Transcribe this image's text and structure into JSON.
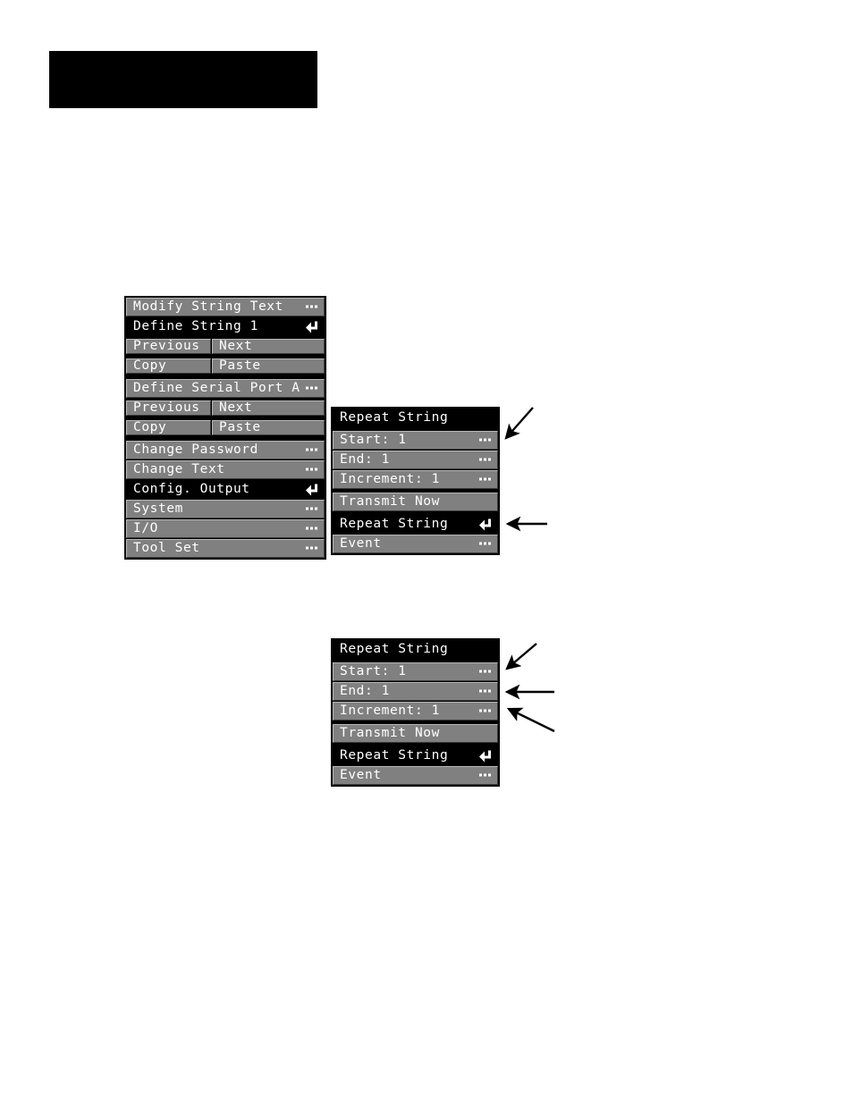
{
  "page": {
    "background": "#ffffff",
    "redaction_bar_color": "#000000"
  },
  "colors": {
    "lcd_background": "#000000",
    "row_unselected": "#808080",
    "row_selected": "#000000",
    "text": "#ffffff"
  },
  "left_panel": {
    "name": "configuration-menu",
    "groups": [
      {
        "name": "string-group",
        "rows": [
          {
            "type": "single",
            "label": "Modify String Text",
            "marker": "ellipsis-icon",
            "selected": false
          },
          {
            "type": "single",
            "label": "Define String 1",
            "marker": "return-icon",
            "selected": true
          },
          {
            "type": "split",
            "left": "Previous",
            "right": "Next",
            "selected": false
          },
          {
            "type": "split",
            "left": "Copy",
            "right": "Paste",
            "selected": false
          }
        ]
      },
      {
        "name": "serial-port-group",
        "rows": [
          {
            "type": "single",
            "label": "Define Serial Port A",
            "marker": "ellipsis-icon",
            "selected": false
          },
          {
            "type": "split",
            "left": "Previous",
            "right": "Next",
            "selected": false
          },
          {
            "type": "split",
            "left": "Copy",
            "right": "Paste",
            "selected": false
          }
        ]
      },
      {
        "name": "main-menu-group",
        "rows": [
          {
            "type": "single",
            "label": "Change Password",
            "marker": "ellipsis-icon",
            "selected": false
          },
          {
            "type": "single",
            "label": "Change Text",
            "marker": "ellipsis-icon",
            "selected": false
          },
          {
            "type": "single",
            "label": "Config. Output",
            "marker": "return-icon",
            "selected": true
          },
          {
            "type": "single",
            "label": "System",
            "marker": "ellipsis-icon",
            "selected": false
          },
          {
            "type": "single",
            "label": "I/O",
            "marker": "ellipsis-icon",
            "selected": false
          },
          {
            "type": "single",
            "label": "Tool Set",
            "marker": "ellipsis-icon",
            "selected": false
          }
        ]
      }
    ]
  },
  "repeat_panel_top": {
    "name": "repeat-string-menu-top",
    "groups": [
      {
        "name": "title-group",
        "rows": [
          {
            "type": "single",
            "label": "Repeat String",
            "marker": "none",
            "selected": true
          }
        ]
      },
      {
        "name": "parameters-group",
        "rows": [
          {
            "type": "single",
            "label": "Start: 1",
            "marker": "ellipsis-icon",
            "selected": false
          },
          {
            "type": "single",
            "label": "End: 1",
            "marker": "ellipsis-icon",
            "selected": false
          },
          {
            "type": "single",
            "label": "Increment: 1",
            "marker": "ellipsis-icon",
            "selected": false
          }
        ]
      },
      {
        "name": "transmit-group",
        "rows": [
          {
            "type": "single",
            "label": "Transmit Now",
            "marker": "none",
            "selected": false
          }
        ]
      },
      {
        "name": "mode-group",
        "rows": [
          {
            "type": "single",
            "label": "Repeat String",
            "marker": "return-icon",
            "selected": true
          },
          {
            "type": "single",
            "label": "Event",
            "marker": "ellipsis-icon",
            "selected": false
          }
        ]
      }
    ]
  },
  "repeat_panel_bottom": {
    "name": "repeat-string-menu-bottom",
    "groups": [
      {
        "name": "title-group",
        "rows": [
          {
            "type": "single",
            "label": "Repeat String",
            "marker": "none",
            "selected": true
          }
        ]
      },
      {
        "name": "parameters-group",
        "rows": [
          {
            "type": "single",
            "label": "Start: 1",
            "marker": "ellipsis-icon",
            "selected": false
          },
          {
            "type": "single",
            "label": "End: 1",
            "marker": "ellipsis-icon",
            "selected": false
          },
          {
            "type": "single",
            "label": "Increment: 1",
            "marker": "ellipsis-icon",
            "selected": false
          }
        ]
      },
      {
        "name": "transmit-group",
        "rows": [
          {
            "type": "single",
            "label": "Transmit Now",
            "marker": "none",
            "selected": false
          }
        ]
      },
      {
        "name": "mode-group",
        "rows": [
          {
            "type": "single",
            "label": "Repeat String",
            "marker": "return-icon",
            "selected": true
          },
          {
            "type": "single",
            "label": "Event",
            "marker": "ellipsis-icon",
            "selected": false
          }
        ]
      }
    ]
  },
  "callout_arrows": [
    {
      "name": "arrow-to-start-row-top",
      "style": "diagonal-down-left"
    },
    {
      "name": "arrow-to-repeat-string-top",
      "style": "horizontal-left"
    },
    {
      "name": "arrow-to-start-row",
      "style": "diagonal-down-left"
    },
    {
      "name": "arrow-to-end-row",
      "style": "horizontal-left"
    },
    {
      "name": "arrow-to-increment-row",
      "style": "diagonal-up-left"
    }
  ]
}
